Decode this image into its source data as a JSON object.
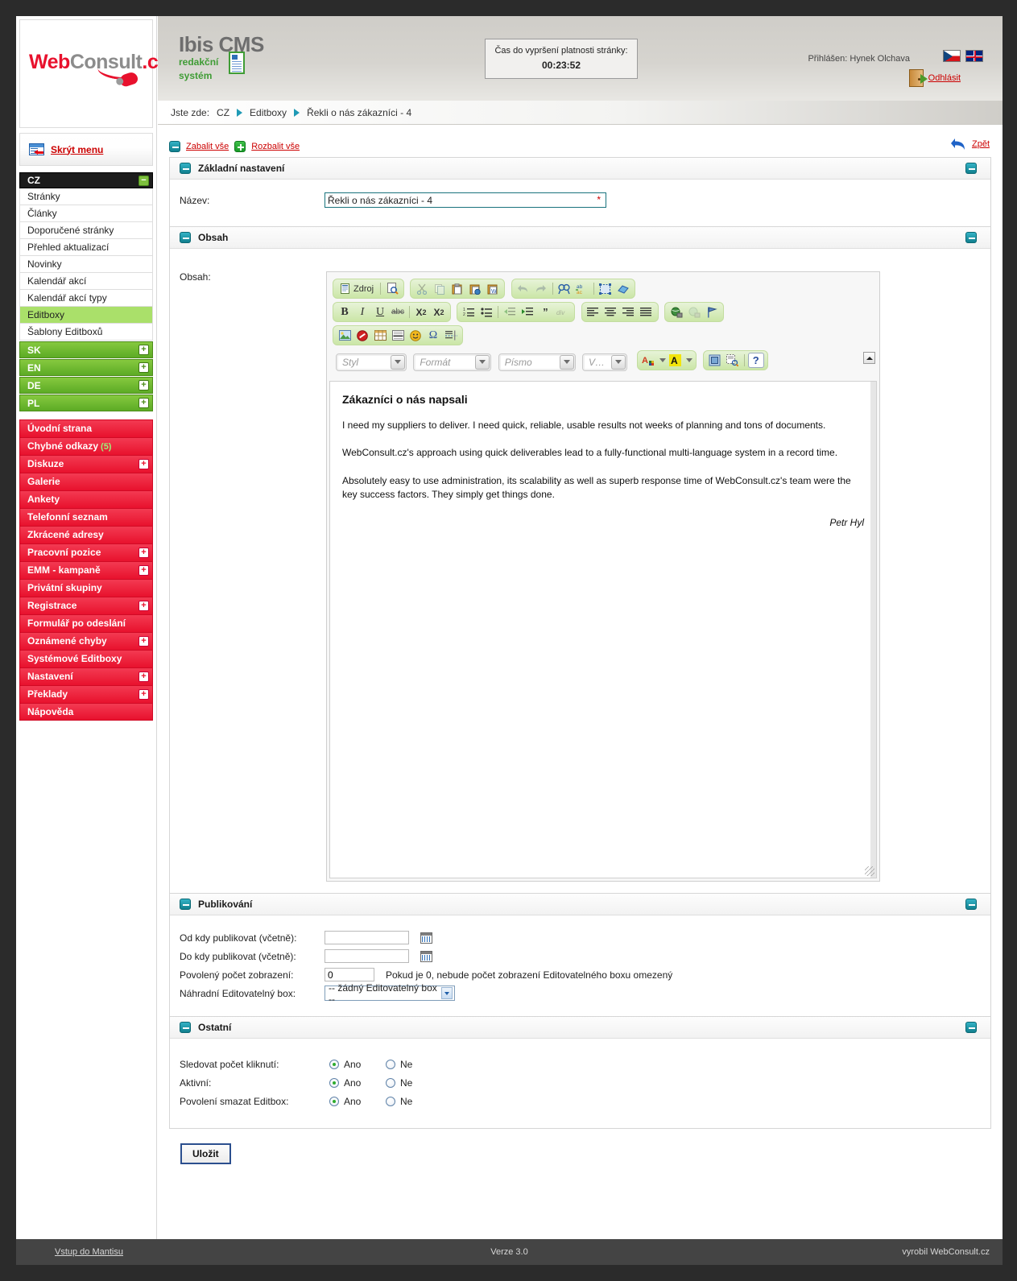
{
  "brand": {
    "logo_web": "Web",
    "logo_consult": "Consult",
    "logo_cz": ".cz"
  },
  "sidebar": {
    "hide_menu_label": "Skrýt menu",
    "group_cz": {
      "label": "CZ",
      "toggle": "−"
    },
    "cz_items": [
      "Stránky",
      "Články",
      "Doporučené stránky",
      "Přehled aktualizací",
      "Novinky",
      "Kalendář akcí",
      "Kalendář akcí typy",
      "Editboxy",
      "Šablony Editboxů"
    ],
    "selected_item": "Editboxy",
    "languages": [
      {
        "label": "SK",
        "toggle": "+"
      },
      {
        "label": "EN",
        "toggle": "+"
      },
      {
        "label": "DE",
        "toggle": "+"
      },
      {
        "label": "PL",
        "toggle": "+"
      }
    ],
    "red_items": [
      {
        "label": "Úvodní strana",
        "badge": "",
        "expand": false
      },
      {
        "label": "Chybné odkazy",
        "badge": "(5)",
        "expand": false
      },
      {
        "label": "Diskuze",
        "badge": "",
        "expand": true
      },
      {
        "label": "Galerie",
        "badge": "",
        "expand": false
      },
      {
        "label": "Ankety",
        "badge": "",
        "expand": false
      },
      {
        "label": "Telefonní seznam",
        "badge": "",
        "expand": false
      },
      {
        "label": "Zkrácené adresy",
        "badge": "",
        "expand": false
      },
      {
        "label": "Pracovní pozice",
        "badge": "",
        "expand": true
      },
      {
        "label": "EMM - kampaně",
        "badge": "",
        "expand": true
      },
      {
        "label": "Privátní skupiny",
        "badge": "",
        "expand": false
      },
      {
        "label": "Registrace",
        "badge": "",
        "expand": true
      },
      {
        "label": "Formulář po odeslání",
        "badge": "",
        "expand": false
      },
      {
        "label": "Oznámené chyby",
        "badge": "",
        "expand": true
      },
      {
        "label": "Systémové Editboxy",
        "badge": "",
        "expand": false
      },
      {
        "label": "Nastavení",
        "badge": "",
        "expand": true
      },
      {
        "label": "Překlady",
        "badge": "",
        "expand": true
      },
      {
        "label": "Nápověda",
        "badge": "",
        "expand": false
      }
    ]
  },
  "header": {
    "app_name_line1": "Ibis CMS",
    "app_name_line2": "redakční",
    "app_name_line3": "systém",
    "timer_label": "Čas do vypršení platnosti stránky:",
    "timer_value": "00:23:52",
    "user_label": "Přihlášen: Hynek Olchava",
    "logout_label": "Odhlásit",
    "flag_cz": "flag-cz-icon",
    "flag_en": "flag-uk-icon"
  },
  "breadcrumb": {
    "prefix": "Jste zde:",
    "items": [
      "CZ",
      "Editboxy",
      "Řekli o nás zákazníci - 4"
    ]
  },
  "toolbar": {
    "collapse_all": "Zabalit vše",
    "expand_all": "Rozbalit vše",
    "back": "Zpět"
  },
  "panels": {
    "basic": {
      "title": "Základní nastavení",
      "name_label": "Název:",
      "name_value": "Řekli o nás zákazníci - 4",
      "required_mark": "*"
    },
    "content": {
      "title": "Obsah",
      "label": "Obsah:"
    },
    "publishing": {
      "title": "Publikování",
      "from_label": "Od kdy publikovat (včetně):",
      "from_value": "",
      "to_label": "Do kdy publikovat (včetně):",
      "to_value": "",
      "count_label": "Povolený počet zobrazení:",
      "count_value": "0",
      "count_hint": "Pokud je 0, nebude počet zobrazení Editovatelného boxu omezený",
      "replacement_label": "Náhradní Editovatelný box:",
      "replacement_value": "-- žádný Editovatelný box --"
    },
    "other": {
      "title": "Ostatní",
      "rows": [
        {
          "label": "Sledovat počet kliknutí:",
          "yes": "Ano",
          "no": "Ne",
          "selected": "yes"
        },
        {
          "label": "Aktivní:",
          "yes": "Ano",
          "no": "Ne",
          "selected": "yes"
        },
        {
          "label": "Povolení smazat Editbox:",
          "yes": "Ano",
          "no": "Ne",
          "selected": "yes"
        }
      ]
    }
  },
  "editor": {
    "source_label": "Zdroj",
    "style_placeholder": "Styl",
    "format_placeholder": "Formát",
    "font_placeholder": "Písmo",
    "size_placeholder": "V…",
    "document": {
      "heading": "Zákazníci o nás napsali",
      "p1": "I need my suppliers to deliver. I need quick, reliable, usable results not weeks of planning and tons of documents.",
      "p2": "WebConsult.cz's approach using quick deliverables lead to a fully-functional multi-language system in a record time.",
      "p3": "Absolutely easy to use administration, its scalability as well as superb response time of WebConsult.cz's team were the key success factors. They simply get things done.",
      "signature": "Petr Hyl"
    }
  },
  "save_button": "Uložit",
  "footer": {
    "left": "Vstup do Mantisu",
    "center": "Verze 3.0",
    "right": "vyrobil WebConsult.cz"
  }
}
